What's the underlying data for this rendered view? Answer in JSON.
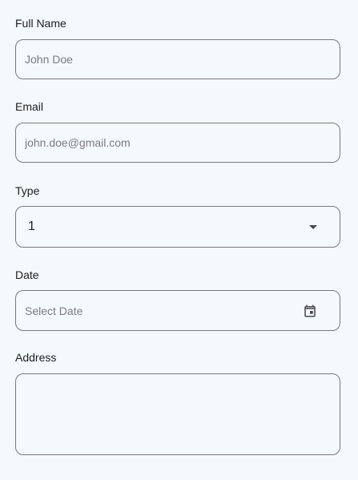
{
  "form": {
    "full_name": {
      "label": "Full Name",
      "placeholder": "John Doe",
      "value": ""
    },
    "email": {
      "label": "Email",
      "placeholder": "john.doe@gmail.com",
      "value": ""
    },
    "type": {
      "label": "Type",
      "selected_value": "1",
      "icon": "dropdown-arrow-icon"
    },
    "date": {
      "label": "Date",
      "placeholder": "Select Date",
      "value": "",
      "icon": "calendar-icon"
    },
    "address": {
      "label": "Address",
      "value": ""
    }
  },
  "colors": {
    "background": "#f3f9fd",
    "border": "#7b7880",
    "label_text": "#1d1b20",
    "placeholder_text": "#7d7a82",
    "icon": "#49454f"
  }
}
